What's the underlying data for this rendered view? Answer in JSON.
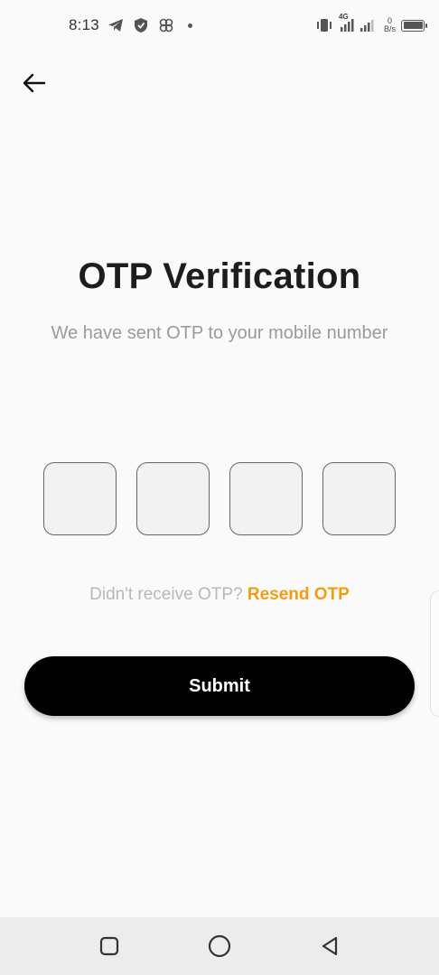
{
  "status_bar": {
    "time": "8:13",
    "network_type": "4G",
    "net_speed_value": "0",
    "net_speed_unit": "B/s",
    "icons": [
      "telegram-icon",
      "shield-icon",
      "pinwheel-icon",
      "notification-dot-icon",
      "vibrate-icon",
      "signal-icon",
      "battery-icon"
    ]
  },
  "header": {
    "back_icon": "arrow-left-icon"
  },
  "main": {
    "title": "OTP Verification",
    "subtitle": "We have sent OTP to your mobile number",
    "otp": {
      "digits": [
        "",
        "",
        "",
        ""
      ]
    },
    "resend_prompt": "Didn't receive OTP?",
    "resend_link": "Resend OTP",
    "submit_label": "Submit"
  },
  "nav_bar": {
    "icons": [
      "recents-square-icon",
      "home-circle-icon",
      "back-triangle-icon"
    ]
  },
  "colors": {
    "background": "#fafafa",
    "accent": "#f39c12",
    "button": "#000000",
    "muted_text": "#9a9a9a"
  }
}
